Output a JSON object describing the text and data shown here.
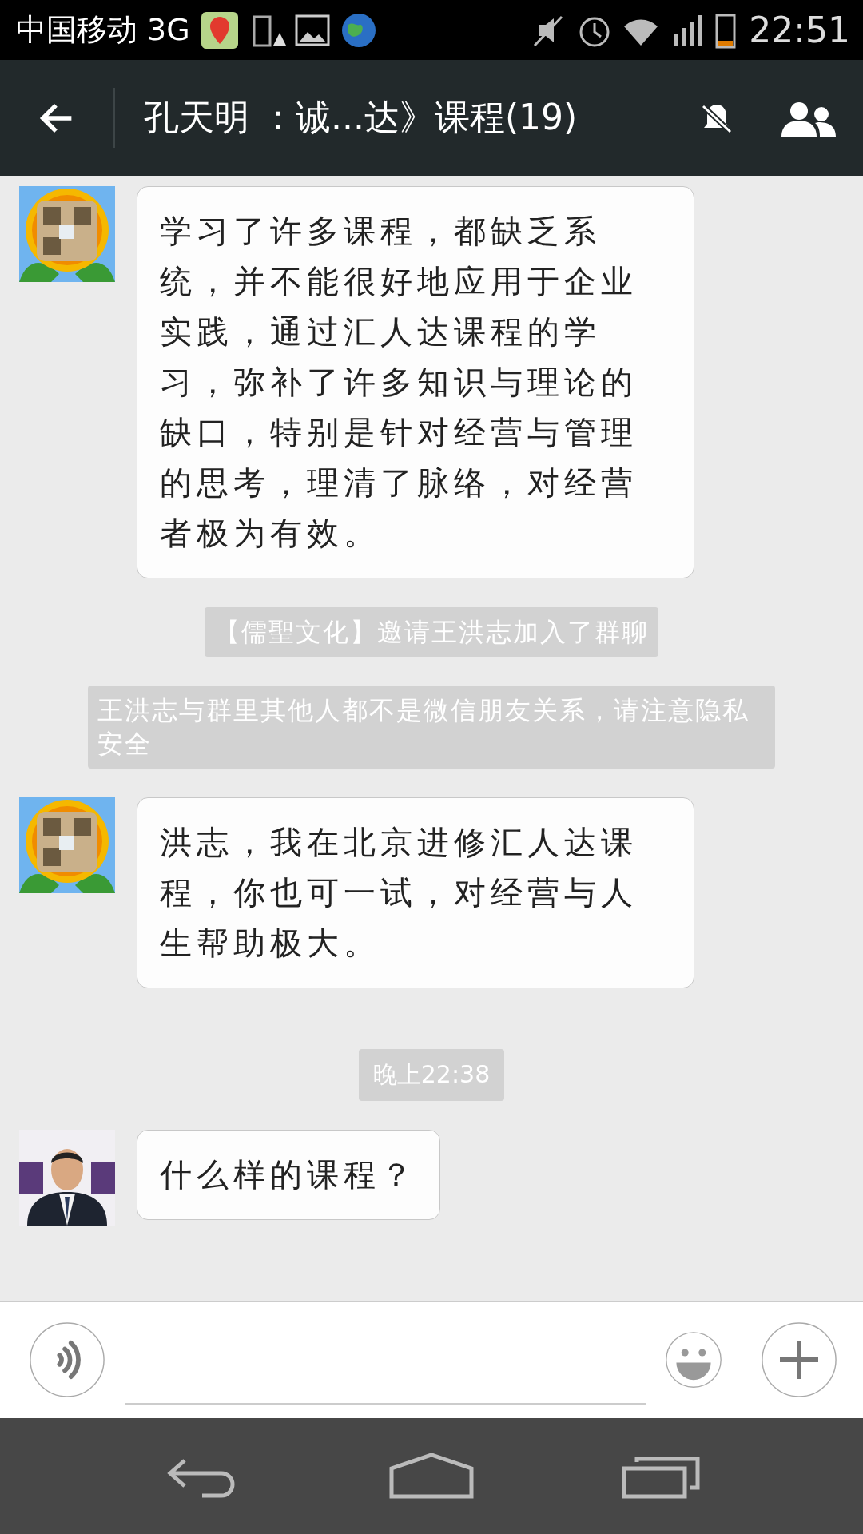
{
  "status_bar": {
    "carrier": "中国移动 3G",
    "time": "22:51"
  },
  "header": {
    "title": "孔天明 ：诚...达》课程(19)",
    "muted": true
  },
  "messages": [
    {
      "kind": "text",
      "text": "学习了许多课程，都缺乏系统，并不能很好地应用于企业实践，通过汇人达课程的学习，弥补了许多知识与理论的缺口，特别是针对经营与管理的思考，理清了脉络，对经营者极为有效。"
    },
    {
      "kind": "system",
      "text": "【儒聖文化】邀请王洪志加入了群聊"
    },
    {
      "kind": "system",
      "text": "王洪志与群里其他人都不是微信朋友关系，请注意隐私安全"
    },
    {
      "kind": "text",
      "text": "洪志，我在北京进修汇人达课程，你也可一试，对经营与人生帮助极大。"
    },
    {
      "kind": "time",
      "text": "晚上22:38"
    },
    {
      "kind": "text",
      "text": "什么样的课程？"
    }
  ]
}
